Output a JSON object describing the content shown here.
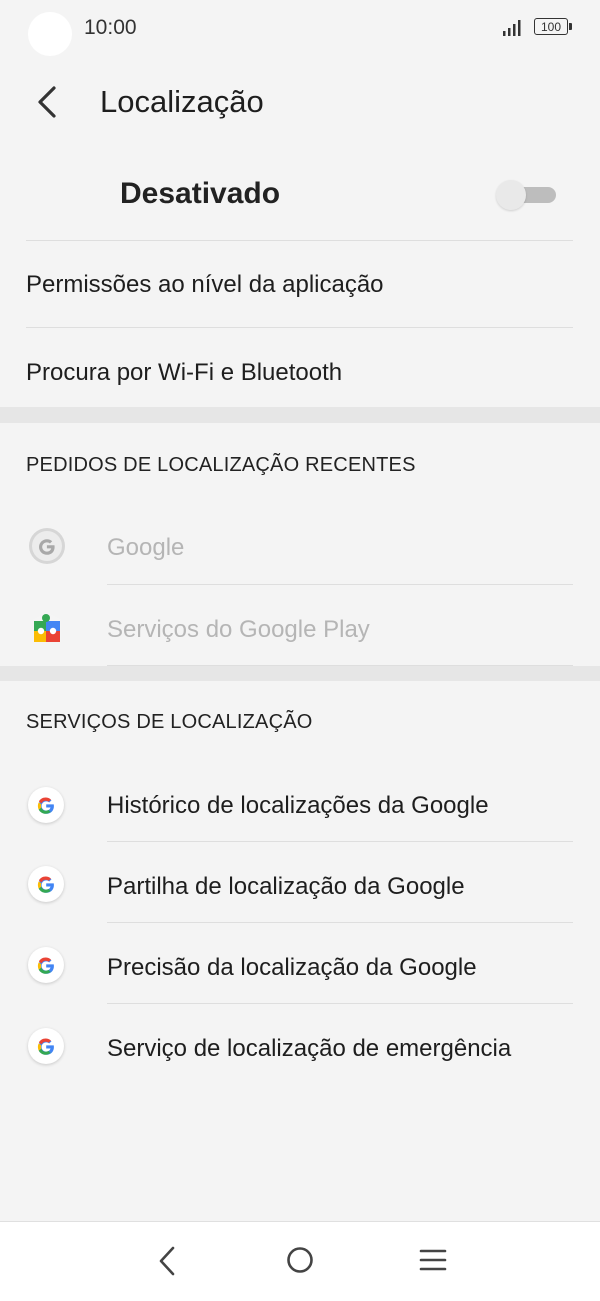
{
  "status_bar": {
    "time": "10:00",
    "battery": "100"
  },
  "app_bar": {
    "title": "Localização"
  },
  "master_switch": {
    "label": "Desativado",
    "state": "off"
  },
  "settings": [
    {
      "label": "Permissões ao nível da aplicação"
    },
    {
      "label": "Procura por Wi-Fi e Bluetooth"
    }
  ],
  "recent_requests": {
    "header": "PEDIDOS DE LOCALIZAÇÃO RECENTES",
    "items": [
      {
        "label": "Google",
        "icon": "google-icon"
      },
      {
        "label": "Serviços do Google Play",
        "icon": "google-play-services-icon"
      }
    ]
  },
  "location_services": {
    "header": "SERVIÇOS DE LOCALIZAÇÃO",
    "items": [
      {
        "label": "Histórico de localizações da Google",
        "icon": "google-icon"
      },
      {
        "label": "Partilha de localização da Google",
        "icon": "google-icon"
      },
      {
        "label": "Precisão da localização da Google",
        "icon": "google-icon"
      },
      {
        "label": "Serviço de localização de emergência",
        "icon": "google-icon"
      }
    ]
  },
  "colors": {
    "background": "#f4f4f4",
    "dimmed_text": "#b5b5b5",
    "toggle_off": "#bdbdbd"
  }
}
